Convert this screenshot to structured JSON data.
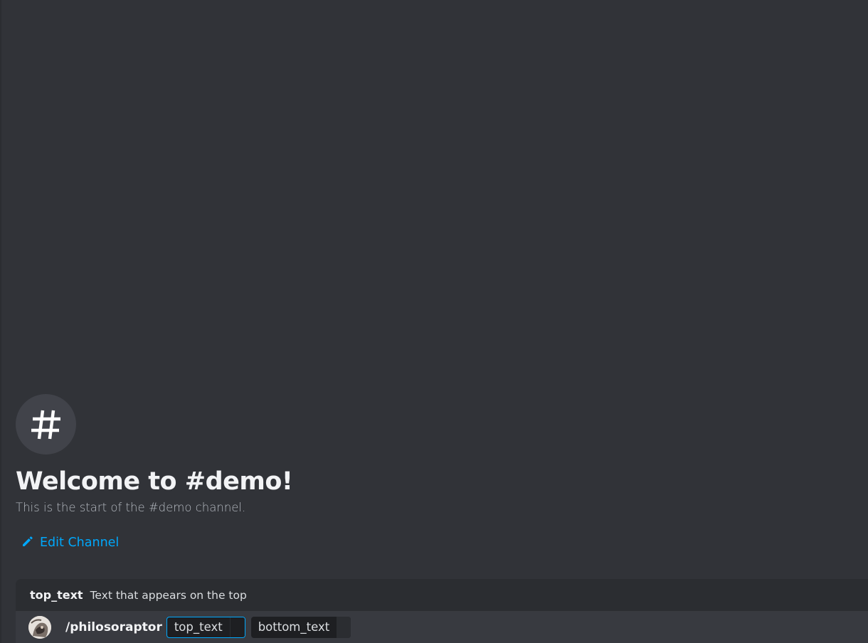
{
  "channel": {
    "welcome_title": "Welcome to #demo!",
    "welcome_subtitle": "This is the start of the #demo channel.",
    "edit_channel_label": "Edit Channel"
  },
  "autocomplete": {
    "option": {
      "name": "top_text",
      "description": "Text that appears on the top"
    },
    "command": {
      "name": "/philosoraptor",
      "params": [
        {
          "label": "top_text",
          "active": true
        },
        {
          "label": "bottom_text",
          "active": false
        }
      ]
    }
  },
  "colors": {
    "background": "#313338",
    "link": "#00a8fc",
    "panel": "#2b2d31",
    "input": "#1e1f22"
  },
  "icons": {
    "channel": "hash-icon",
    "edit": "pencil-icon",
    "avatar": "philosoraptor-avatar"
  }
}
